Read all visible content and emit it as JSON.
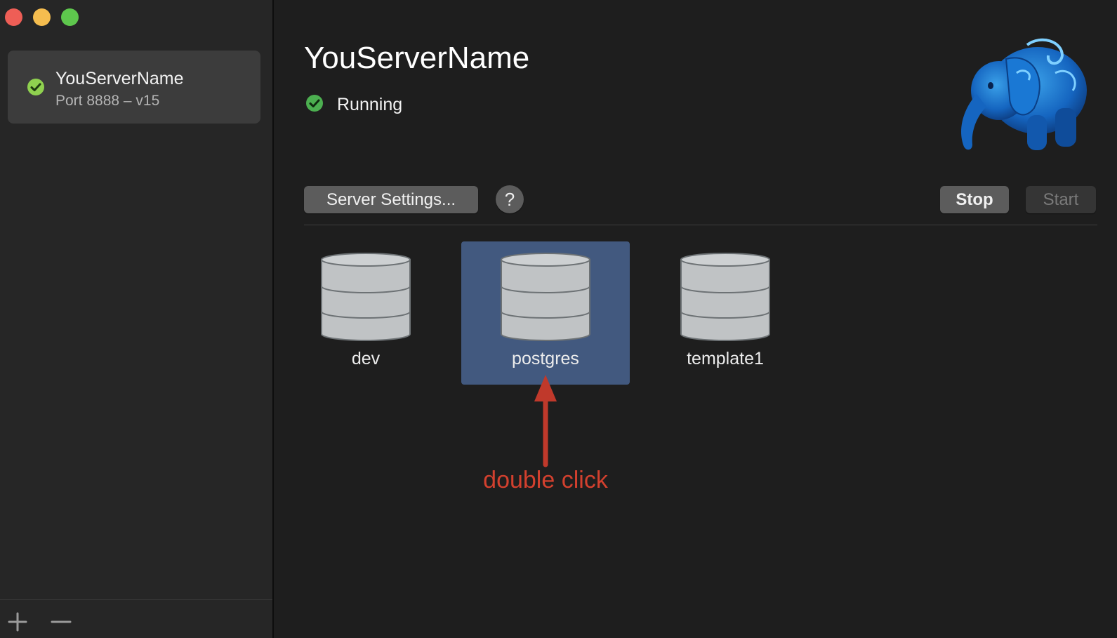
{
  "window": {
    "controls": [
      "close",
      "minimize",
      "maximize"
    ],
    "colors": {
      "close": "#ee5e56",
      "minimize": "#f5bd4f",
      "maximize": "#5ec74d"
    }
  },
  "sidebar": {
    "servers": [
      {
        "name": "YouServerName",
        "subtitle": "Port 8888 – v15",
        "status_icon": "check-circle-icon",
        "selected": true
      }
    ],
    "footer": {
      "add_icon": "plus-icon",
      "remove_icon": "minus-icon"
    }
  },
  "main": {
    "title": "YouServerName",
    "status": {
      "label": "Running",
      "icon": "check-circle-icon",
      "color": "#4caf50"
    },
    "logo_icon": "elephant-logo-icon",
    "toolbar": {
      "settings_label": "Server Settings...",
      "help_label": "?",
      "stop_label": "Stop",
      "start_label": "Start",
      "start_enabled": false
    },
    "databases": [
      {
        "name": "dev",
        "selected": false
      },
      {
        "name": "postgres",
        "selected": true
      },
      {
        "name": "template1",
        "selected": false
      }
    ],
    "annotation": {
      "text": "double click",
      "color": "#d2402e"
    },
    "selection_color": "#42597f"
  }
}
